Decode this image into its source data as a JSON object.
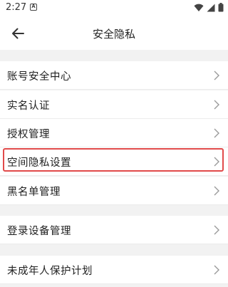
{
  "status_bar": {
    "time": "2:27",
    "notification_icon": "A"
  },
  "header": {
    "title": "安全隐私",
    "back_icon": "arrow-left-icon"
  },
  "groups": [
    {
      "items": [
        {
          "label": "账号安全中心"
        },
        {
          "label": "实名认证"
        },
        {
          "label": "授权管理"
        },
        {
          "label": "空间隐私设置",
          "highlighted": true
        },
        {
          "label": "黑名单管理"
        }
      ]
    },
    {
      "items": [
        {
          "label": "登录设备管理"
        }
      ]
    },
    {
      "items": [
        {
          "label": "未成年人保护计划"
        }
      ]
    }
  ],
  "colors": {
    "highlight": "#e14a4a",
    "background": "#f2f2f2",
    "card": "#ffffff",
    "chevron": "#9a9a9a"
  }
}
